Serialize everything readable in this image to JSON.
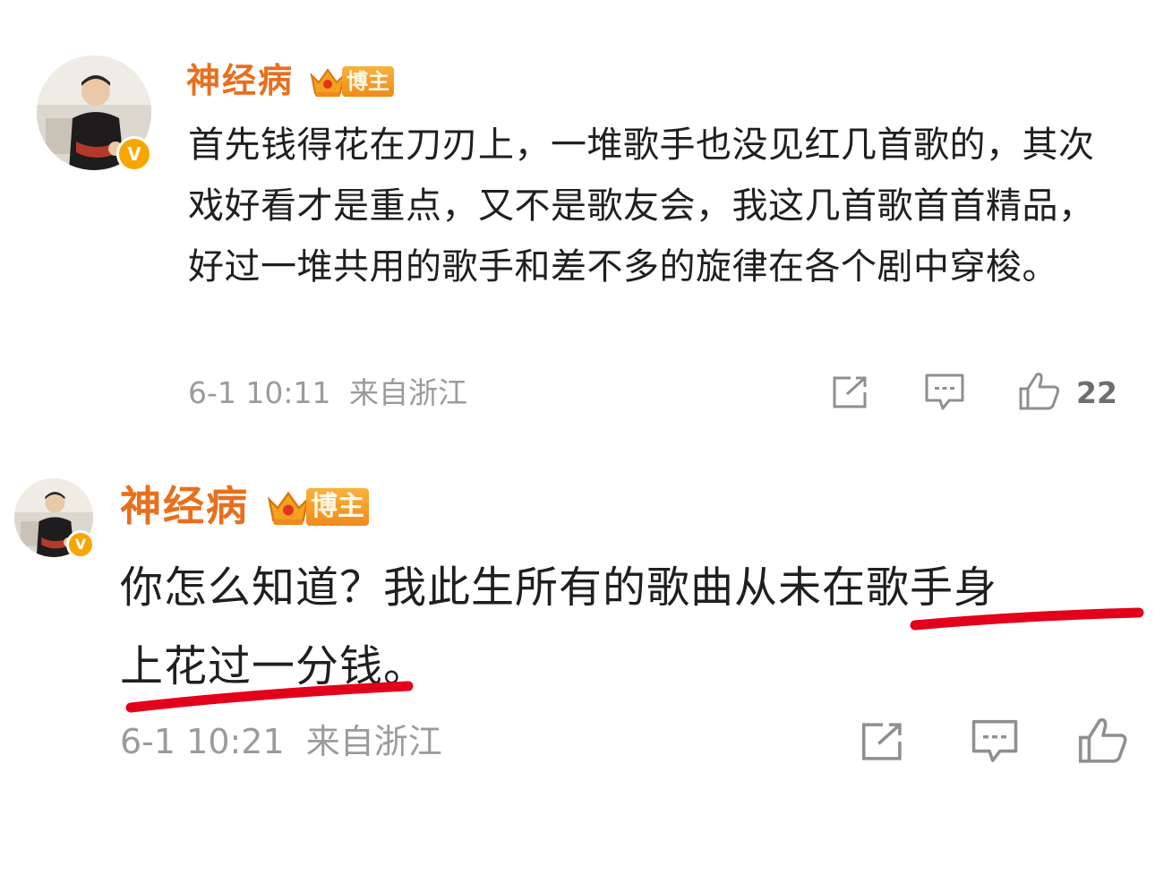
{
  "comments": [
    {
      "user": {
        "name": "神经病",
        "tag": "博主",
        "verified_badge": "V"
      },
      "text": "首先钱得花在刀刃上，一堆歌手也没见红几首歌的，其次戏好看才是重点，又不是歌友会，我这几首歌首首精品，好过一堆共用的歌手和差不多的旋律在各个剧中穿梭。",
      "time": "6-1 10:11",
      "location": "来自浙江",
      "likes": "22"
    },
    {
      "user": {
        "name": "神经病",
        "tag": "博主",
        "verified_badge": "V"
      },
      "text_lines": [
        "你怎么知道？我此生所有的歌曲从未在歌手身",
        "上花过一分钱。"
      ],
      "time": "6-1 10:21",
      "location": "来自浙江",
      "likes": ""
    }
  ],
  "colors": {
    "username": "#e86f1e",
    "tag_bg": "#f7a029",
    "verified": "#f7a600",
    "highlight_underline": "#e3001b",
    "meta": "#9b9b9b",
    "icon": "#8f8f8f"
  },
  "icons": [
    "share-icon",
    "comment-icon",
    "like-icon",
    "crown-icon",
    "verified-icon"
  ]
}
